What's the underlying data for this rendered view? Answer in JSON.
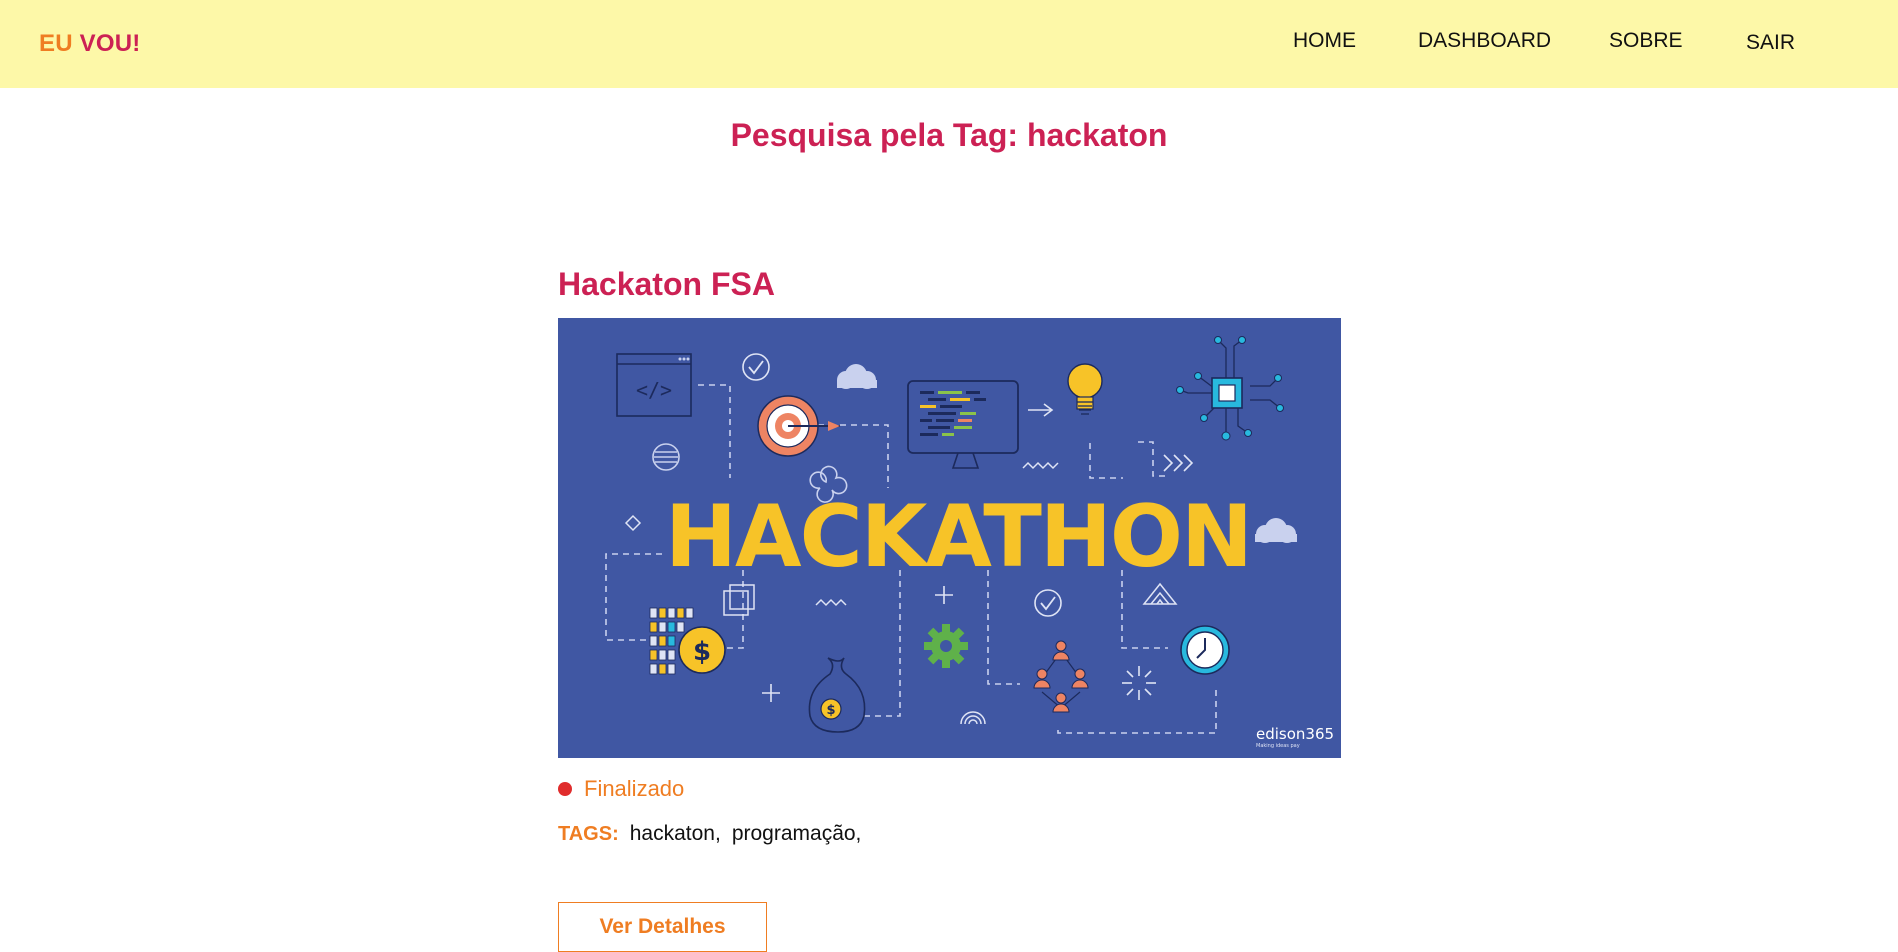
{
  "navbar": {
    "brand_part1": "EU",
    "brand_part2": "VOU!",
    "links": [
      "HOME",
      "DASHBOARD",
      "SOBRE",
      "SAIR"
    ]
  },
  "page": {
    "title": "Pesquisa pela Tag: hackaton"
  },
  "event": {
    "title": "Hackaton FSA",
    "banner": {
      "headline": "HACKATHON",
      "brand": "edison365",
      "brand_tagline": "Making ideas pay"
    },
    "status": "Finalizado",
    "tags_label": "TAGS:",
    "tags": [
      "hackaton,",
      "programação,"
    ],
    "details_button": "Ver Detalhes"
  },
  "colors": {
    "navbar_bg": "#fdf8a8",
    "accent_pink": "#cc2154",
    "accent_orange": "#ef7d22",
    "status_dot": "#e02c2c",
    "banner_bg": "#4057a3",
    "banner_headline": "#f7c328"
  }
}
